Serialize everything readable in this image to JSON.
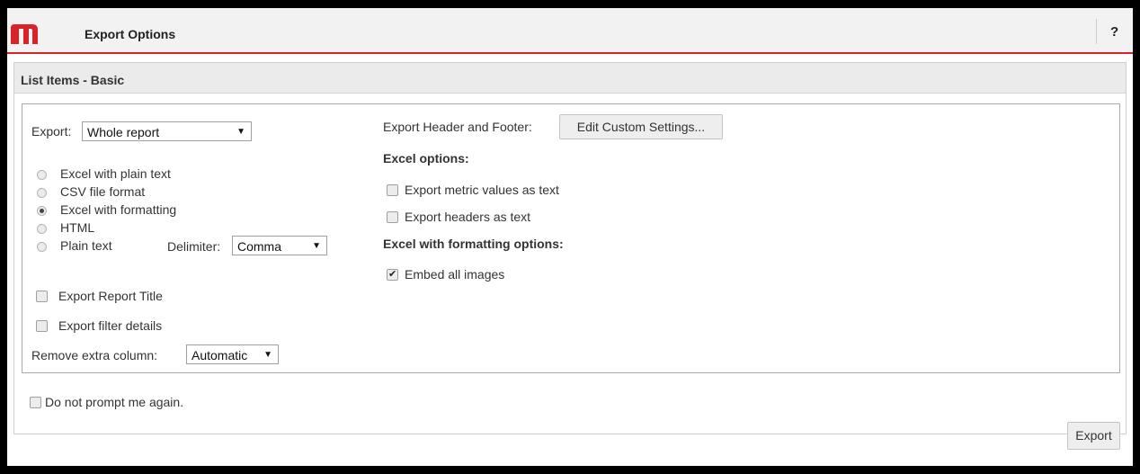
{
  "window": {
    "title": "Export Options",
    "help_label": "?"
  },
  "section": {
    "title": "List Items - Basic"
  },
  "export_scope": {
    "label": "Export:",
    "selected": "Whole report"
  },
  "formats": [
    {
      "label": "Excel with plain text",
      "selected": false
    },
    {
      "label": "CSV file format",
      "selected": false
    },
    {
      "label": "Excel with formatting",
      "selected": true
    },
    {
      "label": "HTML",
      "selected": false
    },
    {
      "label": "Plain text",
      "selected": false
    }
  ],
  "delimiter": {
    "label": "Delimiter:",
    "selected": "Comma"
  },
  "options": {
    "report_title": {
      "label": "Export Report Title",
      "checked": false
    },
    "filter_details": {
      "label": "Export filter details",
      "checked": false
    }
  },
  "remove_extra_column": {
    "label": "Remove extra column:",
    "selected": "Automatic"
  },
  "header_footer": {
    "label": "Export Header and Footer:",
    "button_label": "Edit Custom Settings..."
  },
  "excel_options": {
    "heading": "Excel options:",
    "metric_as_text": {
      "label": "Export metric values as text",
      "checked": false
    },
    "headers_as_text": {
      "label": "Export headers as text",
      "checked": false
    }
  },
  "excel_formatting_options": {
    "heading": "Excel with formatting options:",
    "embed_images": {
      "label": "Embed all images",
      "checked": true
    }
  },
  "no_prompt": {
    "label": "Do not prompt me again.",
    "checked": false
  },
  "export_button_label": "Export",
  "colors": {
    "brand_red": "#d8232a",
    "titlebar_bg": "#f2f2f2",
    "section_header_bg": "#ebebeb"
  }
}
